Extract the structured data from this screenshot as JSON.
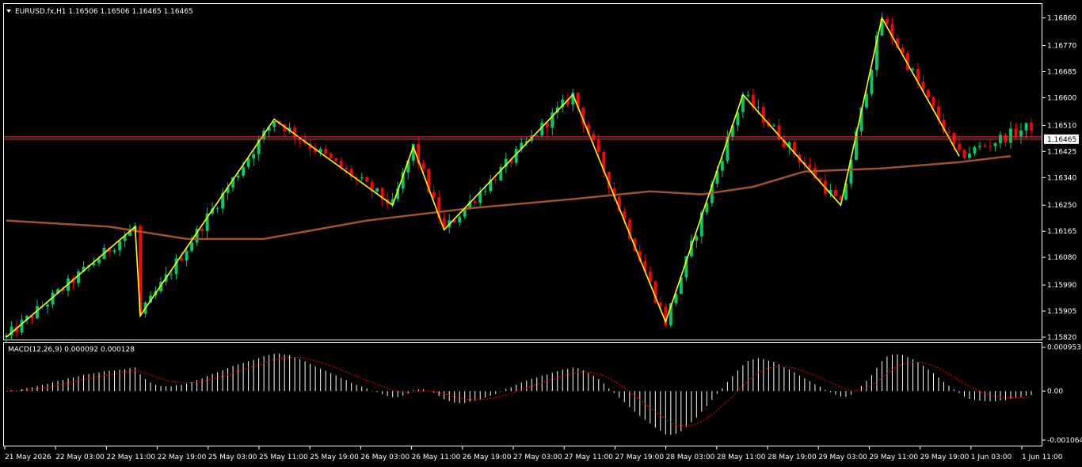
{
  "header": {
    "symbol_line": "EURUSD.fx,H1  1.16506 1.16506 1.16465 1.16465",
    "macd_line": "MACD(12,26,9) 0.000092 0.000128"
  },
  "current_price_label": "1.16465",
  "colors": {
    "background": "#000000",
    "axis": "#ffffff",
    "bull": "#00cc66",
    "bear": "#ff0000",
    "zigzag": "#ffff00",
    "moving_average": "#a0522d",
    "price_line": "#ff3333",
    "macd_hist": "#ffffff",
    "macd_signal": "#ff0000"
  },
  "price_axis": {
    "ticks": [
      "1.16860",
      "1.16770",
      "1.16685",
      "1.16600",
      "1.16510",
      "1.16425",
      "1.16340",
      "1.16250",
      "1.16165",
      "1.16080",
      "1.15990",
      "1.15905",
      "1.15820"
    ],
    "ylim": [
      1.1582,
      1.1689
    ]
  },
  "macd_axis": {
    "ticks": [
      "0.000953",
      "0.00",
      "-0.001064"
    ],
    "ylim": [
      -0.00115,
      0.001
    ]
  },
  "time_axis": {
    "labels": [
      "21 May 2026",
      "22 May 03:00",
      "22 May 11:00",
      "22 May 19:00",
      "25 May 03:00",
      "25 May 11:00",
      "25 May 19:00",
      "26 May 03:00",
      "26 May 11:00",
      "26 May 19:00",
      "27 May 03:00",
      "27 May 11:00",
      "27 May 19:00",
      "28 May 03:00",
      "28 May 11:00",
      "28 May 19:00",
      "29 May 03:00",
      "29 May 11:00",
      "29 May 19:00",
      "1 Jun 03:00",
      "1 Jun 11:00"
    ]
  },
  "chart_data": {
    "type": "candlestick",
    "title": "EURUSD.fx,H1",
    "bar_count": 200,
    "zigzag_points": [
      {
        "bar": 0,
        "price": 1.1582
      },
      {
        "bar": 25,
        "price": 1.1618
      },
      {
        "bar": 26,
        "price": 1.1589
      },
      {
        "bar": 52,
        "price": 1.1653
      },
      {
        "bar": 75,
        "price": 1.1625
      },
      {
        "bar": 79,
        "price": 1.1644
      },
      {
        "bar": 85,
        "price": 1.1617
      },
      {
        "bar": 110,
        "price": 1.1661
      },
      {
        "bar": 128,
        "price": 1.1587
      },
      {
        "bar": 143,
        "price": 1.1661
      },
      {
        "bar": 162,
        "price": 1.1625
      },
      {
        "bar": 170,
        "price": 1.1686
      },
      {
        "bar": 185,
        "price": 1.1641
      }
    ],
    "moving_average": [
      {
        "bar": 0,
        "value": 1.162
      },
      {
        "bar": 20,
        "value": 1.1618
      },
      {
        "bar": 35,
        "value": 1.1614
      },
      {
        "bar": 50,
        "value": 1.1614
      },
      {
        "bar": 70,
        "value": 1.162
      },
      {
        "bar": 90,
        "value": 1.1624
      },
      {
        "bar": 110,
        "value": 1.1627
      },
      {
        "bar": 125,
        "value": 1.16295
      },
      {
        "bar": 135,
        "value": 1.16285
      },
      {
        "bar": 145,
        "value": 1.1631
      },
      {
        "bar": 155,
        "value": 1.1636
      },
      {
        "bar": 170,
        "value": 1.1637
      },
      {
        "bar": 185,
        "value": 1.1639
      },
      {
        "bar": 195,
        "value": 1.1641
      }
    ],
    "current_price": 1.16465,
    "series": [
      {
        "name": "MACD(12,26,9)",
        "last": 9.2e-05
      },
      {
        "name": "Signal",
        "last": 0.000128
      }
    ]
  }
}
